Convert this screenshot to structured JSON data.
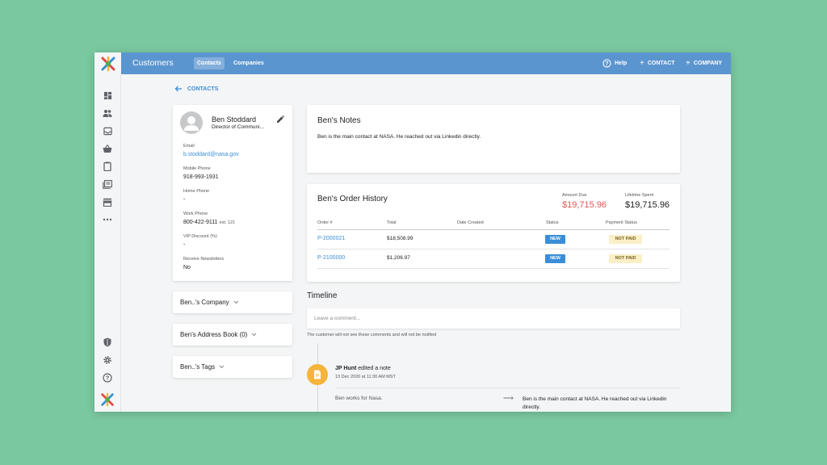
{
  "app": {
    "title": "Customers",
    "tabs": [
      {
        "label": "Contacts"
      },
      {
        "label": "Companies"
      }
    ],
    "actions": {
      "help": "Help",
      "add_contact": "CONTACT",
      "add_company": "COMPANY"
    }
  },
  "sidebar": {
    "items": [
      "dashboard-icon",
      "people-icon",
      "inbox-icon",
      "basket-icon",
      "clipboard-icon",
      "catalog-icon",
      "store-icon",
      "more-icon",
      "shield-icon",
      "gear-icon",
      "help-icon"
    ]
  },
  "back_link": "CONTACTS",
  "contact": {
    "name": "Ben Stoddard",
    "role": "Director of Communi...",
    "fields": {
      "email_label": "Email",
      "email_value": "b.stoddard@nasa.gov",
      "mobile_label": "Mobile Phone",
      "mobile_value": "918-993-1931",
      "home_label": "Home Phone",
      "home_value": "-",
      "work_label": "Work Phone",
      "work_value": "800-422-9111",
      "work_ext": "ext. 121",
      "vip_label": "VIP Discount (%)",
      "vip_value": "-",
      "newsletter_label": "Receive Newsletters",
      "newsletter_value": "No"
    }
  },
  "sections": {
    "company": "Ben..'s Company",
    "address_book": "Ben's Address Book (0)",
    "tags": "Ben..'s Tags"
  },
  "notes": {
    "title": "Ben's Notes",
    "text": "Ben is the main contact at NASA. He reached out via Linkedin directly."
  },
  "orders": {
    "title": "Ben's Order History",
    "amount_due_label": "Amount Due",
    "amount_due": "$19,715.96",
    "lifetime_label": "Lifetime Spent",
    "lifetime": "$19,715.96",
    "columns": {
      "order": "Order #",
      "total": "Total",
      "created": "Date Created",
      "status": "Status",
      "payment": "Payment Status"
    },
    "rows": [
      {
        "order": "P-2000021",
        "total": "$18,508.99",
        "created": "",
        "status": "NEW",
        "payment": "NOT PAID"
      },
      {
        "order": "P-2100000",
        "total": "$1,206.97",
        "created": "",
        "status": "NEW",
        "payment": "NOT PAID"
      }
    ]
  },
  "timeline": {
    "title": "Timeline",
    "comment_placeholder": "Leave a comment...",
    "comment_note": "The customer will not see these comments and will not be notified",
    "event": {
      "author": "JP Hunt",
      "action": "edited a note",
      "time": "13 Dec 2020 at 11:30 AM MST",
      "old_text": "Ben works for Nasa.",
      "new_text": "Ben is the main contact at NASA. He reached out via Linkedin directly."
    }
  },
  "colors": {
    "topbar": "#5b95cf",
    "accent": "#3a8ed8",
    "amount_due": "#e05555",
    "badge_new": "#3a8ed8",
    "badge_not_paid": "#fbefc8",
    "timeline_dot": "#f5b43a",
    "background": "#7ac8a0"
  }
}
